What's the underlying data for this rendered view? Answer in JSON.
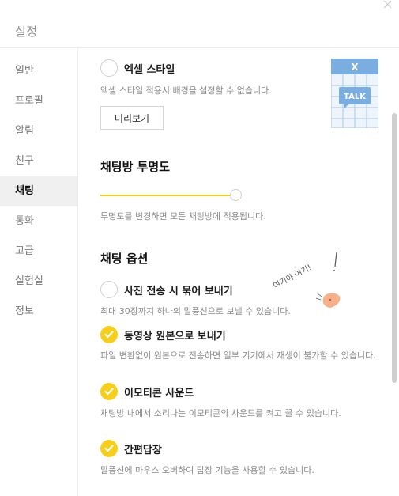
{
  "window": {
    "title": "설정"
  },
  "sidebar": {
    "items": [
      {
        "label": "일반"
      },
      {
        "label": "프로필"
      },
      {
        "label": "알림"
      },
      {
        "label": "친구"
      },
      {
        "label": "채팅",
        "active": true
      },
      {
        "label": "통화"
      },
      {
        "label": "고급"
      },
      {
        "label": "실험실"
      },
      {
        "label": "정보"
      }
    ]
  },
  "excel_style": {
    "label": "엑셀 스타일",
    "checked": false,
    "description": "엑셀 스타일 적용시 배경을 설정할 수 없습니다.",
    "preview_button": "미리보기",
    "thumbnail": {
      "header_glyph": "X",
      "badge_text": "TALK"
    }
  },
  "transparency": {
    "title": "채팅방 투명도",
    "value_fraction": 1.0,
    "description": "투명도를 변경하면 모든 채팅방에 적용됩니다."
  },
  "chat_options": {
    "title": "채팅 옵션",
    "items": [
      {
        "label": "사진 전송 시 묶어 보내기",
        "checked": false,
        "description": "최대 30장까지 하나의 말풍선으로 보낼 수 있습니다."
      },
      {
        "label": "동영상 원본으로 보내기",
        "checked": true,
        "description": "파일 변환없이 원본으로 전송하면 일부 기기에서 재생이 불가할 수 있습니다."
      },
      {
        "label": "이모티콘 사운드",
        "checked": true,
        "description": "채팅방 내에서 소리나는 이모티콘의 사운드를 켜고 끌 수 있습니다."
      },
      {
        "label": "간편답장",
        "checked": true,
        "description": "말풍선에 마우스 오버하여 답장 기능을 사용할 수 있습니다."
      }
    ]
  },
  "annotation": {
    "text": "여기야 여기!"
  },
  "colors": {
    "accent": "#f7cf1a",
    "active_bg": "#f0f0f0",
    "muted_text": "#8a8a8a"
  }
}
